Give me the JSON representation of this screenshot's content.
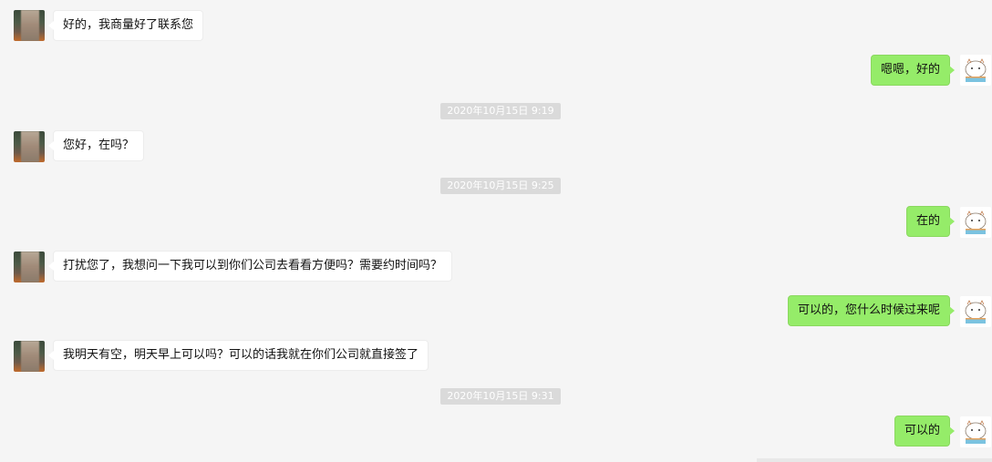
{
  "messages": [
    {
      "side": "left",
      "text": "好的，我商量好了联系您"
    },
    {
      "side": "right",
      "text": "嗯嗯，好的"
    },
    {
      "side": "left",
      "text": "您好，在吗？"
    },
    {
      "side": "right",
      "text": "在的"
    },
    {
      "side": "left",
      "text": "打扰您了，我想问一下我可以到你们公司去看看方便吗？需要约时间吗？"
    },
    {
      "side": "right",
      "text": "可以的，您什么时候过来呢"
    },
    {
      "side": "left",
      "text": "我明天有空，明天早上可以吗？可以的话我就在你们公司就直接签了"
    },
    {
      "side": "right",
      "text": "可以的"
    }
  ],
  "timestamps": [
    "2020年10月15日  9:19",
    "2020年10月15日  9:25",
    "2020年10月15日  9:31"
  ],
  "colors": {
    "background": "#f5f5f5",
    "outgoing_bubble": "#95ec69",
    "incoming_bubble": "#ffffff",
    "timestamp_bg": "#dadada"
  },
  "icons": {
    "contact_avatar": "blurred-photo-avatar",
    "self_avatar": "cartoon-cat-avatar"
  }
}
